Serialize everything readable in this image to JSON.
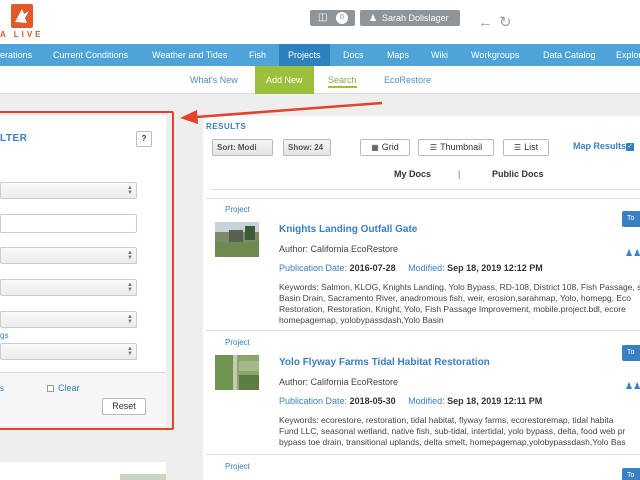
{
  "header": {
    "logo_text": "A LIVE",
    "cart_count": "0",
    "user_name": "Sarah Dolislager"
  },
  "nav": {
    "items": [
      {
        "label": "erations"
      },
      {
        "label": "Current Conditions"
      },
      {
        "label": "Weather and Tides"
      },
      {
        "label": "Fish"
      },
      {
        "label": "Projects"
      },
      {
        "label": "Docs"
      },
      {
        "label": "Maps"
      },
      {
        "label": "Wiki"
      },
      {
        "label": "Workgroups"
      },
      {
        "label": "Data Catalog"
      },
      {
        "label": "Explor"
      }
    ],
    "active": "Projects"
  },
  "subnav": {
    "items": [
      {
        "label": "What's New"
      },
      {
        "label": "Add New"
      },
      {
        "label": "Search"
      },
      {
        "label": "EcoRestore"
      }
    ]
  },
  "filter": {
    "title": "LTER",
    "help_label": "?",
    "tags_link": "gs",
    "s_link": "s",
    "clear_label": "Clear",
    "reset_label": "Reset"
  },
  "results": {
    "label": "RESULTS",
    "sort_value": "Sort: Modi",
    "show_value": "Show: 24",
    "grid_label": "Grid",
    "thumbnail_label": "Thumbnail",
    "list_label": "List",
    "map_results_label": "Map Results",
    "tabs": [
      {
        "label": "My Docs"
      },
      {
        "label": "Public Docs"
      }
    ],
    "tab_separator": "|",
    "tool_label": "To",
    "cards": [
      {
        "type": "Project",
        "title": "Knights Landing Outfall Gate",
        "author": "Author: California EcoRestore",
        "pub_label": "Publication Date:",
        "pub_date": "2016-07-28",
        "mod_label": "Modified:",
        "mod_date": "Sep 18, 2019 12:12 PM",
        "keywords": [
          "Keywords: Salmon, KLOG, Knights Landing, Yolo Bypass, RD-108, District 108, Fish Passage, s",
          "Basin Drain, Sacramento River, anadromous fish, weir, erosion,sarahmap, Yolo, homepg, Eco",
          "Restoration, Restoration, Knight, Yolo, Fish Passage Improvement, mobile.project.bdl, ecore",
          "homepagemap, yolobypassdash,Yolo Basin"
        ]
      },
      {
        "type": "Project",
        "title": "Yolo Flyway Farms Tidal Habitat Restoration",
        "author": "Author: California EcoRestore",
        "pub_label": "Publication Date:",
        "pub_date": "2018-05-30",
        "mod_label": "Modified:",
        "mod_date": "Sep 18, 2019 12:11 PM",
        "keywords": [
          "Keywords: ecorestore, restoration, tidal habitat, flyway farms, ecorestoremap, tidal habita",
          "Fund LLC, seasonal wetland, native fish, sub-tidal, intertidal, yolo bypass, delta, food web pr",
          "bypass toe drain, transitional uplands, delta smelt, homepagemap,yolobypassdash,Yolo Bas"
        ]
      },
      {
        "type": "Project"
      }
    ]
  },
  "colors": {
    "nav_bg": "#4ea4d9",
    "nav_active": "#2e80bf",
    "add_new": "#9cc03b",
    "link": "#3a7fc1",
    "highlight": "#e2432a"
  }
}
